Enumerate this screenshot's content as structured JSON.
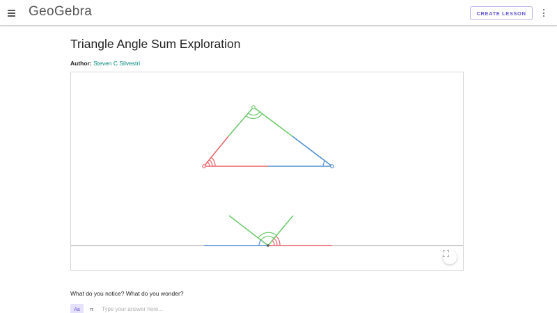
{
  "header": {
    "logo": "GeoGebra",
    "create_lesson_label": "CREATE LESSON",
    "icons": [
      "hamburger-menu-icon",
      "more-vert-icon"
    ]
  },
  "page": {
    "title": "Triangle Angle Sum Exploration",
    "author_label": "Author:",
    "author_name": "Steven C Silvestri"
  },
  "applet": {
    "colors": {
      "red": "#e8646a",
      "green": "#6dcb6d",
      "blue": "#4f8fd0",
      "point": "#e8646a",
      "axis": "#9b9b9b"
    },
    "fullscreen_icon": "fullscreen-icon"
  },
  "question": {
    "prompt": "What do you notice? What do you wonder?",
    "placeholder": "Type your answer here...",
    "text_tool_label": "Aa",
    "math_tool_label": "π"
  }
}
